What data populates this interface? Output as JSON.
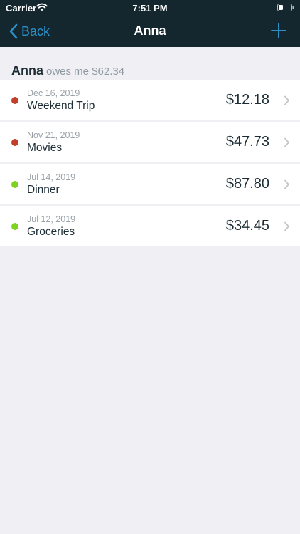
{
  "status_bar": {
    "carrier": "Carrier",
    "time": "7:51 PM",
    "wifi_icon": "wifi-icon",
    "battery_icon": "battery-icon"
  },
  "nav": {
    "back_label": "Back",
    "title": "Anna",
    "add_icon": "plus-icon",
    "accent": "#2c8fc6",
    "background": "#14272f"
  },
  "summary": {
    "name": "Anna",
    "text": "owes me $62.34"
  },
  "colors": {
    "owed_dot": "#c0402a",
    "paid_dot": "#7ed321",
    "page_background": "#efeff4"
  },
  "transactions": [
    {
      "date": "Dec 16, 2019",
      "label": "Weekend Trip",
      "amount": "$12.18",
      "status": "owed"
    },
    {
      "date": "Nov 21, 2019",
      "label": "Movies",
      "amount": "$47.73",
      "status": "owed"
    },
    {
      "date": "Jul 14, 2019",
      "label": "Dinner",
      "amount": "$87.80",
      "status": "paid"
    },
    {
      "date": "Jul 12, 2019",
      "label": "Groceries",
      "amount": "$34.45",
      "status": "paid"
    }
  ]
}
